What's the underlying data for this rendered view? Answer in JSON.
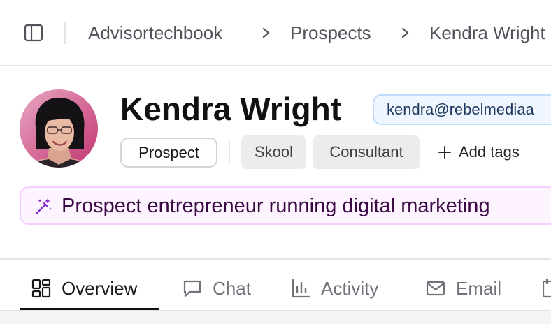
{
  "breadcrumb": {
    "items": [
      "Advisortechbook",
      "Prospects",
      "Kendra Wright"
    ]
  },
  "contact": {
    "name": "Kendra Wright",
    "email": "kendra@rebelmediaa",
    "status": "Prospect",
    "tags": [
      "Skool",
      "Consultant"
    ],
    "add_tags_label": "Add tags",
    "summary": "Prospect entrepreneur running digital marketing"
  },
  "tabs": [
    {
      "label": "Overview",
      "icon": "grid-icon",
      "active": true
    },
    {
      "label": "Chat",
      "icon": "chat-bubble-icon",
      "active": false
    },
    {
      "label": "Activity",
      "icon": "bar-chart-icon",
      "active": false
    },
    {
      "label": "Email",
      "icon": "envelope-icon",
      "active": false
    }
  ],
  "colors": {
    "email_pill_bg": "#eff6ff",
    "email_pill_border": "#bfdbfe",
    "summary_bg": "#fdf4ff",
    "summary_border": "#f5d0fe",
    "summary_text": "#3b0a45",
    "active_tab": "#111111"
  }
}
